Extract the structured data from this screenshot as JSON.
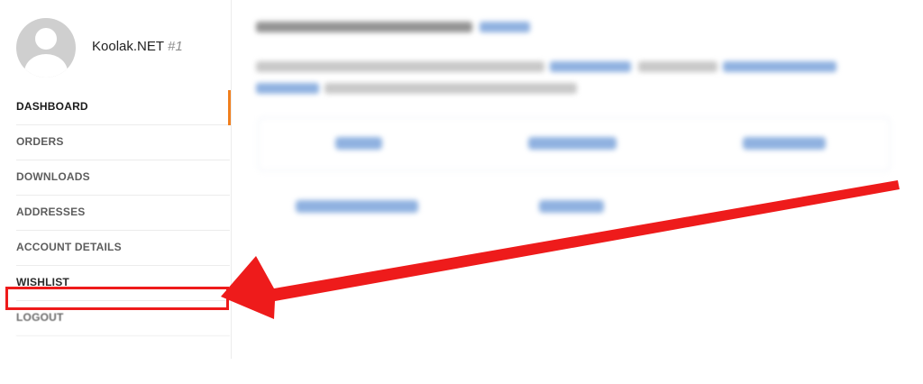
{
  "user": {
    "name": "Koolak.NET",
    "id_label": "#1"
  },
  "nav": {
    "dashboard": "DASHBOARD",
    "orders": "ORDERS",
    "downloads": "DOWNLOADS",
    "addresses": "ADDRESSES",
    "account_details": "ACCOUNT DETAILS",
    "wishlist": "WISHLIST",
    "logout": "LOGOUT"
  },
  "colors": {
    "active_indicator": "#f07f1e",
    "annotation_red": "#ee1b1b",
    "blurred_link": "#8fb1e0"
  },
  "icons": {
    "avatar": "user-silhouette-icon"
  }
}
